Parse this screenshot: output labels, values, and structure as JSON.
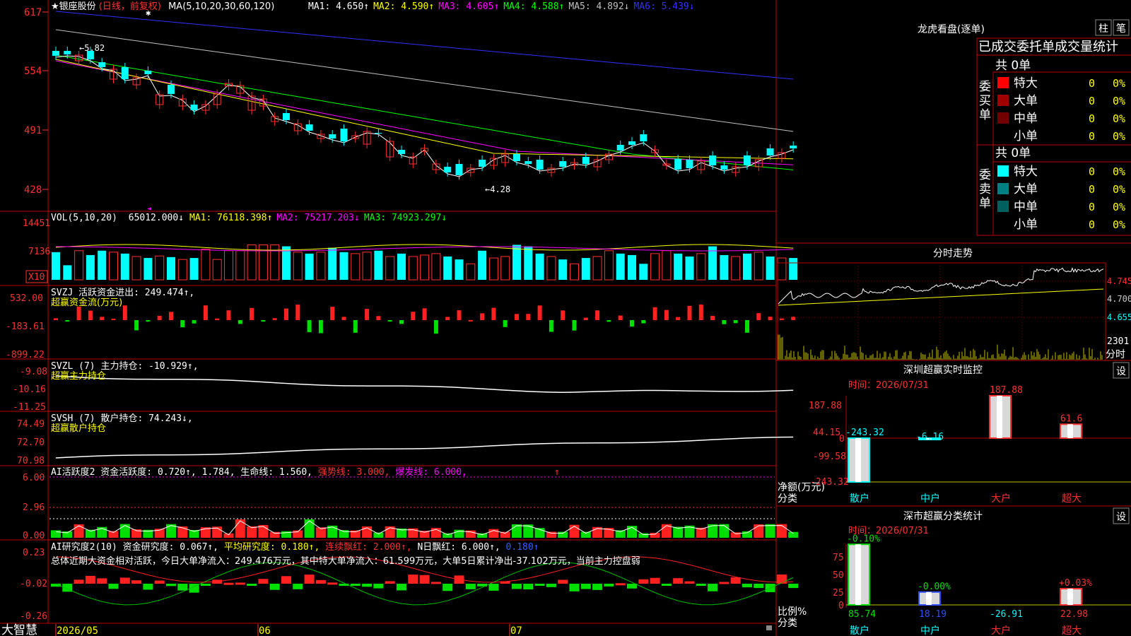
{
  "main": {
    "title": "★银座股份",
    "period": "(日线，前复权)",
    "ma_params": "MA(5,10,20,30,60,120)",
    "ma_values": [
      {
        "label": "MA1: 4.650↑",
        "color": "#ffffff"
      },
      {
        "label": "MA2: 4.590↑",
        "color": "#ffff00"
      },
      {
        "label": "MA3: 4.605↑",
        "color": "#ff00ff"
      },
      {
        "label": "MA4: 4.588↑",
        "color": "#00ff00"
      },
      {
        "label": "MA5: 4.892↓",
        "color": "#c0c0c0"
      },
      {
        "label": "MA6: 5.439↓",
        "color": "#3030ff"
      }
    ],
    "y_ticks": [
      "617",
      "554",
      "491",
      "428"
    ],
    "high_label": "←5.82",
    "low_label": "←4.28"
  },
  "vol": {
    "header": "VOL(5,10,20)",
    "value": "65012.000↓",
    "ma": [
      {
        "label": "MA1: 76118.398↑",
        "color": "#ffff00"
      },
      {
        "label": "MA2: 75217.203↓",
        "color": "#ff00ff"
      },
      {
        "label": "MA3: 74923.297↓",
        "color": "#00ff00"
      }
    ],
    "y_ticks": [
      "14451",
      "7136"
    ],
    "unit": "X10",
    "bars": [
      0.95,
      0.5,
      1.0,
      0.85,
      1.0,
      0.95,
      0.9,
      0.8,
      0.75,
      0.82,
      0.78,
      0.7,
      0.75,
      1.05,
      0.7,
      1.0,
      1.0,
      1.2,
      1.2,
      1.2,
      1.15,
      0.95,
      0.9,
      0.95,
      1.1,
      0.95,
      0.9,
      0.95,
      1.0,
      0.8,
      0.9,
      0.8,
      0.85,
      0.9,
      0.8,
      0.7,
      0.55,
      1.0,
      0.75,
      0.8,
      1.2,
      1.15,
      0.9,
      0.8,
      0.7,
      0.55,
      0.75,
      0.8,
      1.0,
      0.9,
      0.85,
      0.55,
      0.9,
      1.0,
      0.9,
      0.8,
      0.9,
      1.15,
      0.85,
      0.8,
      0.9,
      0.95,
      0.8,
      0.75,
      0.75
    ]
  },
  "svzj": {
    "header": "SVZJ  活跃资金进出: 249.474↑,",
    "sub": "超赢资金流(万元)",
    "y_ticks": [
      "532.00",
      "-183.61",
      "-899.22"
    ]
  },
  "svzl": {
    "header": "SVZL (7) 主力持仓: -10.929↑,",
    "sub": "超赢主力持仓",
    "y_ticks": [
      "-9.08",
      "-10.16",
      "-11.25"
    ]
  },
  "svsh": {
    "header": "SVSH (7) 散户持仓: 74.243↓,",
    "sub": "超赢散户持仓",
    "y_ticks": [
      "74.49",
      "72.70",
      "70.98"
    ]
  },
  "ai_active": {
    "header_parts": [
      {
        "t": "AI活跃度2 资金活跃度: 0.720↑, 1.784, 生命线: 1.560, ",
        "c": "#ffffff"
      },
      {
        "t": "强势线: 3.000, ",
        "c": "#ff3030"
      },
      {
        "t": "爆发线: 6.000,",
        "c": "#ff00ff"
      }
    ],
    "y_ticks": [
      "6.00",
      "2.96",
      "0.00"
    ]
  },
  "ai_research": {
    "header_parts": [
      {
        "t": "AI研究度2(10) 资金研究度: 0.067↑, ",
        "c": "#ffffff"
      },
      {
        "t": "平均研究度: 0.180↑, ",
        "c": "#ffff00"
      },
      {
        "t": "连续飘红: 2.000↑, ",
        "c": "#ff3030"
      },
      {
        "t": "N日飘红: 6.000↑, ",
        "c": "#ffffff"
      },
      {
        "t": "0.180↑",
        "c": "#3060ff"
      }
    ],
    "summary": "总体近期大资金相对活跃，今日大单净流入：249.476万元，其中特大单净流入：61.599万元，大单5日累计净出-37.102万元，当前主力控盘弱",
    "y_ticks": [
      "0.23",
      "-0.02",
      "-0.26"
    ]
  },
  "bottom": {
    "brand": "大智慧",
    "dates": [
      "2026/05",
      "06",
      "07"
    ]
  },
  "right": {
    "dragon_title": "龙虎看盘(逐单)",
    "btn_bar": "柱",
    "btn_pen": "笔",
    "order_title": "已成交委托单成交量统计",
    "buy_label": "委买单",
    "sell_label": "委卖单",
    "buy_total": "共 0单",
    "sell_total": "共 0单",
    "buy_rows": [
      {
        "name": "特大",
        "count": "0",
        "pct": "0%",
        "color": "#ff0000"
      },
      {
        "name": "大单",
        "count": "0",
        "pct": "0%",
        "color": "#a00000"
      },
      {
        "name": "中单",
        "count": "0",
        "pct": "0%",
        "color": "#700000"
      },
      {
        "name": "小单",
        "count": "0",
        "pct": "0%",
        "color": ""
      }
    ],
    "sell_rows": [
      {
        "name": "特大",
        "count": "0",
        "pct": "0%",
        "color": "#00ffff"
      },
      {
        "name": "大单",
        "count": "0",
        "pct": "0%",
        "color": "#008080"
      },
      {
        "name": "中单",
        "count": "0",
        "pct": "0%",
        "color": "#006060"
      },
      {
        "name": "小单",
        "count": "0",
        "pct": "0%",
        "color": ""
      }
    ],
    "intraday_title": "分时走势",
    "intraday_ticks": [
      "4.745",
      "4.700",
      "4.655"
    ],
    "intraday_vol": "2301",
    "intraday_unit": "分时",
    "monitor_title": "深圳超赢实时监控",
    "monitor_btn": "设",
    "monitor_time": "时间：2026/07/31",
    "monitor_y": [
      "187.88",
      "44.15",
      "0",
      "-99.58",
      "-243.32"
    ],
    "monitor_ylabel": "净额(万元)",
    "monitor_xlabel": "分类",
    "monitor_values": [
      "-243.32",
      "-6.16",
      "187.88",
      "61.6"
    ],
    "monitor_cats": [
      "散户",
      "中户",
      "大户",
      "超大"
    ],
    "stat_title": "深市超赢分类统计",
    "stat_btn": "设",
    "stat_time": "时间：2026/07/31",
    "stat_y": [
      "75",
      "50",
      "25",
      "0"
    ],
    "stat_ylabel": "比例%",
    "stat_xlabel": "分类",
    "stat_top": [
      "-0.10%",
      "-0.00%",
      "+0.03%"
    ],
    "stat_values": [
      "85.74",
      "18.19",
      "-26.91",
      "22.98"
    ],
    "stat_cats": [
      "散户",
      "中户",
      "大户",
      "超大"
    ]
  }
}
